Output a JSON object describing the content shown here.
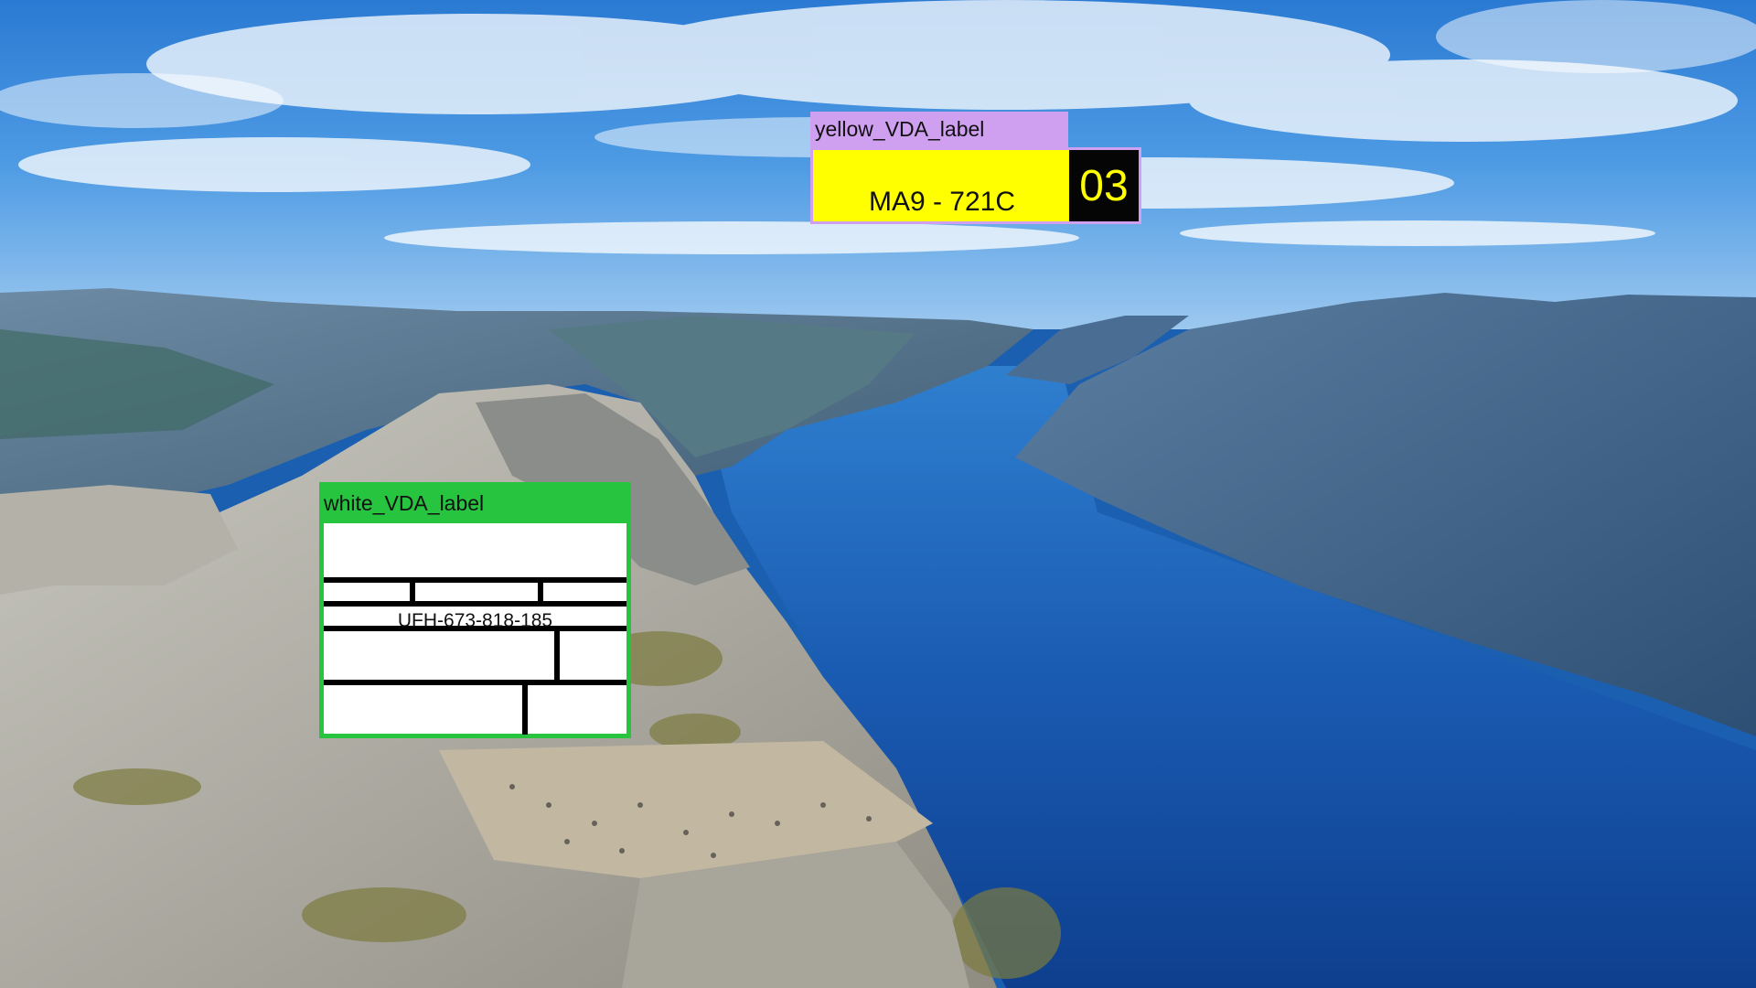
{
  "labels": {
    "yellow": {
      "tag": "yellow_VDA_label",
      "code": "MA9 - 721C",
      "number": "03",
      "tag_color": "#cf9ff0",
      "label_color": "#ffff00"
    },
    "white": {
      "tag": "white_VDA_label",
      "code": "UFH-673-818-185",
      "tag_color": "#27c43f",
      "label_color": "#ffffff"
    }
  },
  "scene": {
    "description_icon": "fjord-landscape-photo"
  }
}
